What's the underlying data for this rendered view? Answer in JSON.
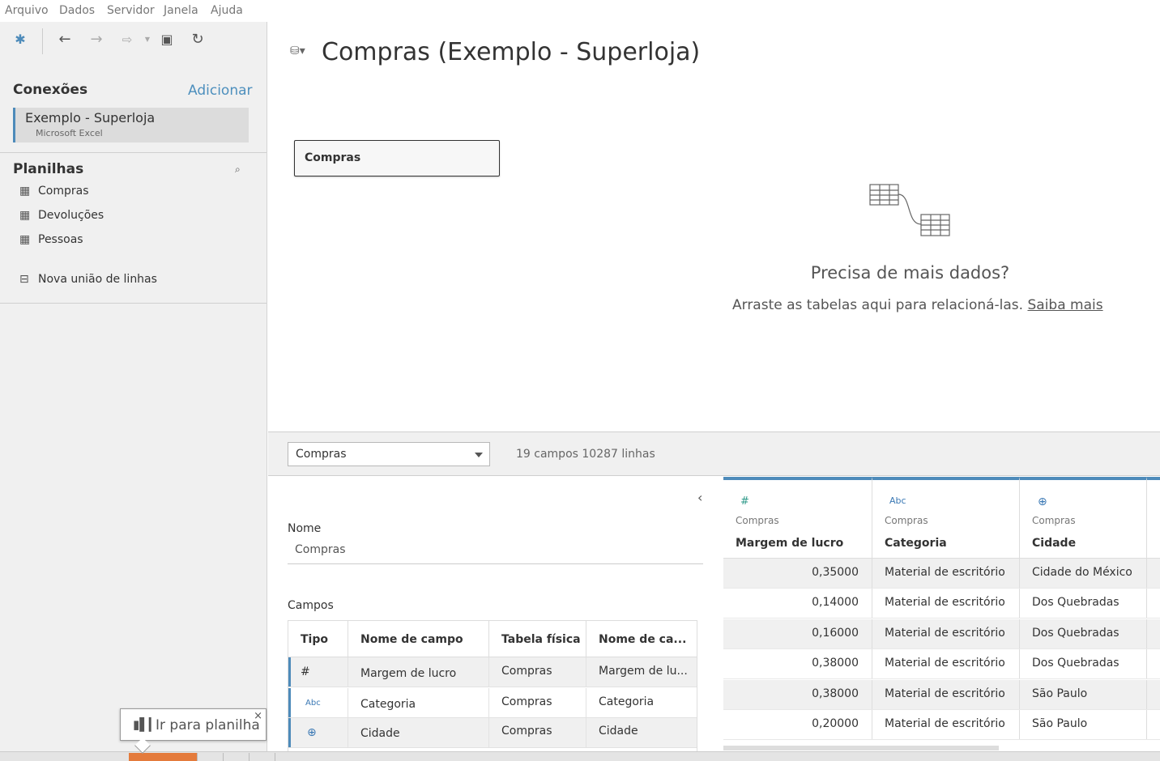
{
  "menu": [
    "Arquivo",
    "Dados",
    "Servidor",
    "Janela",
    "Ajuda"
  ],
  "toolbar": {
    "icons": [
      "tableau-logo-icon",
      "back-icon",
      "forward-icon",
      "paste-icon",
      "save-icon",
      "refresh-icon"
    ]
  },
  "sidebar": {
    "connections_title": "Conexões",
    "add_label": "Adicionar",
    "connection": {
      "name": "Exemplo - Superloja",
      "type": "Microsoft Excel"
    },
    "sheets_title": "Planilhas",
    "sheets": [
      "Compras",
      "Devoluções",
      "Pessoas"
    ],
    "new_union": "Nova união de linhas"
  },
  "canvas": {
    "title": "Compras (Exemplo - Superloja)",
    "table": "Compras",
    "need_title": "Precisa de mais dados?",
    "need_sub": "Arraste as tabelas aqui para relacioná-las.",
    "learn_more": "Saiba mais"
  },
  "midbar": {
    "selected_table": "Compras",
    "stats": "19 campos 10287 linhas"
  },
  "metadata": {
    "name_label": "Nome",
    "name_value": "Compras",
    "fields_label": "Campos",
    "headers": [
      "Tipo",
      "Nome de campo",
      "Tabela física",
      "Nome de ca..."
    ],
    "rows": [
      {
        "type": "#",
        "field": "Margem de lucro",
        "table": "Compras",
        "remote": "Margem de lu..."
      },
      {
        "type": "Abc",
        "field": "Categoria",
        "table": "Compras",
        "remote": "Categoria"
      },
      {
        "type": "globe",
        "field": "Cidade",
        "table": "Compras",
        "remote": "Cidade"
      }
    ]
  },
  "grid": {
    "columns": [
      {
        "type": "#",
        "source": "Compras",
        "name": "Margem de lucro"
      },
      {
        "type": "Abc",
        "source": "Compras",
        "name": "Categoria"
      },
      {
        "type": "globe",
        "source": "Compras",
        "name": "Cidade"
      }
    ],
    "rows": [
      [
        "0,35000",
        "Material de escritório",
        "Cidade do México"
      ],
      [
        "0,14000",
        "Material de escritório",
        "Dos Quebradas"
      ],
      [
        "0,16000",
        "Material de escritório",
        "Dos Quebradas"
      ],
      [
        "0,38000",
        "Material de escritório",
        "Dos Quebradas"
      ],
      [
        "0,38000",
        "Material de escritório",
        "São Paulo"
      ],
      [
        "0,20000",
        "Material de escritório",
        "São Paulo"
      ]
    ]
  },
  "tooltip": {
    "text": "Ir para planilha",
    "close": "×"
  },
  "colors": {
    "accent": "#4e8bba",
    "link": "#4d8fbd",
    "active_tab": "#e47b3c",
    "number_icon": "#2f9a8a"
  }
}
